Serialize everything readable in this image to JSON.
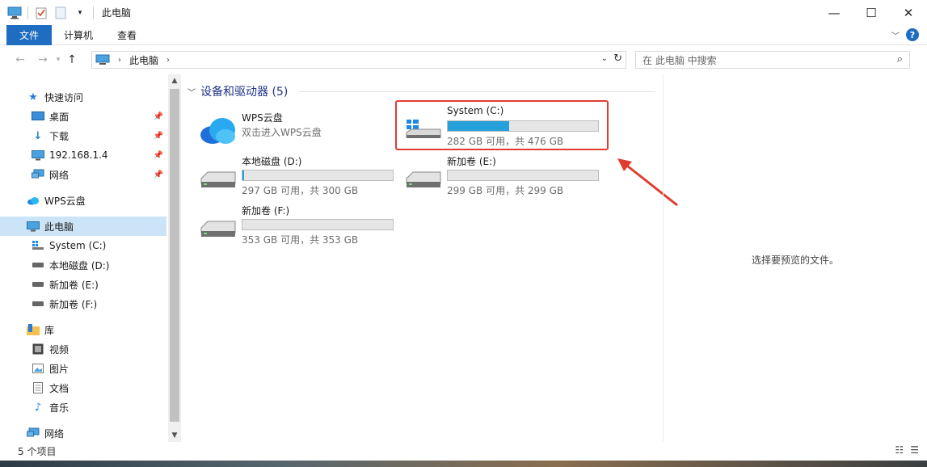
{
  "window": {
    "title": "此电脑"
  },
  "ribbon": {
    "tabs": [
      "文件",
      "计算机",
      "查看"
    ]
  },
  "address": {
    "crumb": "此电脑",
    "search_placeholder": "在 此电脑 中搜索"
  },
  "nav": {
    "quick_access": "快速访问",
    "desktop": "桌面",
    "downloads": "下载",
    "network_ip": "192.168.1.4",
    "network_pinned": "网络",
    "wps_cloud": "WPS云盘",
    "this_pc": "此电脑",
    "drive_c": "System (C:)",
    "drive_d": "本地磁盘 (D:)",
    "drive_e": "新加卷 (E:)",
    "drive_f": "新加卷 (F:)",
    "library": "库",
    "videos": "视频",
    "pictures": "图片",
    "documents": "文档",
    "music": "音乐",
    "network": "网络"
  },
  "content": {
    "group_title": "设备和驱动器 (5)",
    "wps": {
      "name": "WPS云盘",
      "sub": "双击进入WPS云盘"
    },
    "drives": [
      {
        "name": "System (C:)",
        "sub": "282 GB 可用，共 476 GB",
        "used_fraction": 0.41
      },
      {
        "name": "本地磁盘 (D:)",
        "sub": "297 GB 可用，共 300 GB",
        "used_fraction": 0.01
      },
      {
        "name": "新加卷 (E:)",
        "sub": "299 GB 可用，共 299 GB",
        "used_fraction": 0.0
      },
      {
        "name": "新加卷 (F:)",
        "sub": "353 GB 可用，共 353 GB",
        "used_fraction": 0.0
      }
    ]
  },
  "preview_text": "选择要预览的文件。",
  "status": {
    "count": "5 个项目"
  },
  "colors": {
    "accent": "#1e6dc1",
    "bar_fill": "#26a0da",
    "highlight": "#e03c31",
    "group_header": "#1e3287"
  }
}
